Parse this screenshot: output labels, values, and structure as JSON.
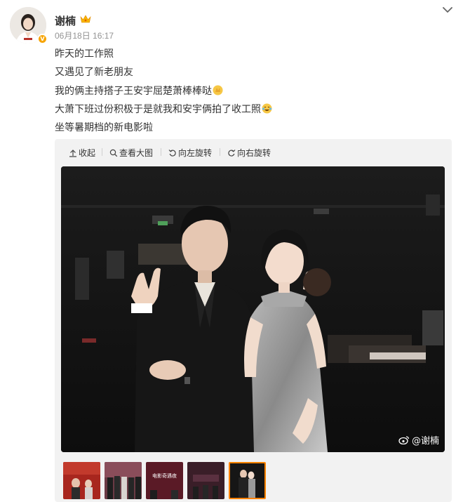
{
  "post": {
    "username": "谢楠",
    "timestamp": "06月18日 16:17",
    "lines": [
      "昨天的工作照",
      "又遇见了新老朋友",
      "我的俩主持搭子王安宇屈楚萧棒棒哒",
      "大萧下班过份积极于是就我和安宇俩拍了收工照",
      "坐等暑期档的新电影啦"
    ],
    "emoji_line3": "clap-emoji",
    "emoji_line4": "laugh-cry-emoji",
    "vip_icon": "crown-icon",
    "verified_icon": "verified-badge"
  },
  "toolbar": {
    "collapse": "收起",
    "view_large": "查看大图",
    "rotate_left": "向左旋转",
    "rotate_right": "向右旋转"
  },
  "photo": {
    "watermark": "@谢楠"
  },
  "thumbnails": [
    {
      "caption": "",
      "active": false
    },
    {
      "caption": "",
      "active": false
    },
    {
      "caption": "电影奇遇夜",
      "active": false
    },
    {
      "caption": "",
      "active": false
    },
    {
      "caption": "",
      "active": true
    }
  ],
  "colors": {
    "accent": "#ff8200",
    "text": "#333333",
    "muted": "#939393",
    "panel": "#f2f2f2"
  }
}
